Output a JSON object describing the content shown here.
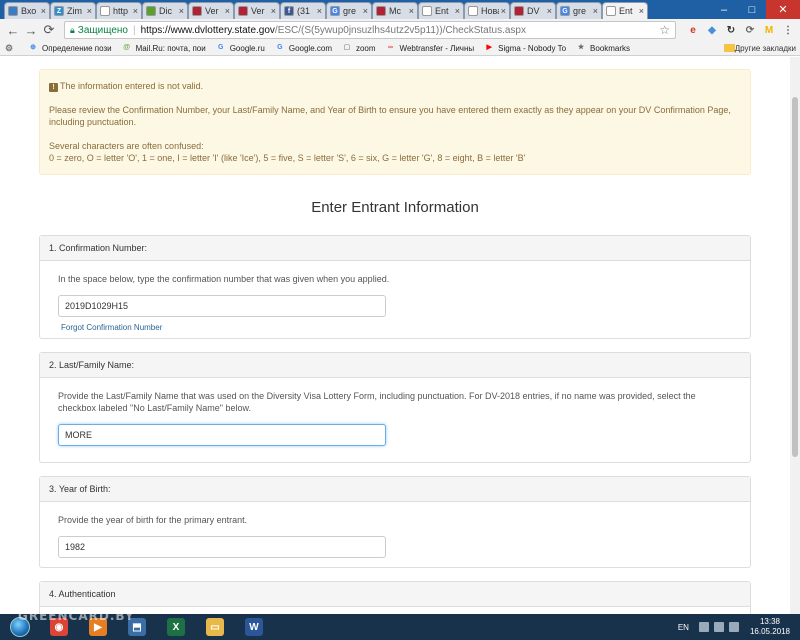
{
  "browser": {
    "tabs": [
      {
        "label": "Вхо",
        "color": "#3b7bc7",
        "glyph": "",
        "active": false
      },
      {
        "label": "Zim",
        "color": "#2c8ed6",
        "glyph": "Z",
        "active": false
      },
      {
        "label": "http",
        "color": "#ffffff",
        "glyph": "",
        "active": false
      },
      {
        "label": "Dic",
        "color": "#5aa02c",
        "glyph": "",
        "active": false
      },
      {
        "label": "Ver",
        "color": "#b22234",
        "glyph": "",
        "active": false
      },
      {
        "label": "Ver",
        "color": "#b22234",
        "glyph": "",
        "active": false
      },
      {
        "label": "(31",
        "color": "#3b5998",
        "glyph": "f",
        "active": false
      },
      {
        "label": "gre",
        "color": "#4285f4",
        "glyph": "G",
        "active": false
      },
      {
        "label": "Mc",
        "color": "#b22234",
        "glyph": "",
        "active": false
      },
      {
        "label": "Ent",
        "color": "#ffffff",
        "glyph": "",
        "active": false
      },
      {
        "label": "Новая",
        "color": "#ffffff",
        "glyph": "",
        "active": false
      },
      {
        "label": "DV",
        "color": "#b22234",
        "glyph": "",
        "active": false
      },
      {
        "label": "gre",
        "color": "#4285f4",
        "glyph": "G",
        "active": false
      },
      {
        "label": "Ent",
        "color": "#ffffff",
        "glyph": "",
        "active": true
      }
    ],
    "tab_close": "×",
    "window_controls": {
      "minimize": "–",
      "maximize": "□",
      "close": "✕"
    },
    "nav": {
      "back": "←",
      "forward": "→",
      "reload": "⟳"
    },
    "address": {
      "secure_label": "Защищено",
      "separator": "|",
      "host": "https://www.dvlottery.state.gov",
      "path": "/ESC/(S(5ywup0jnsuzlhs4utz2v5p11))/CheckStatus.aspx"
    },
    "star": "☆",
    "extensions": [
      {
        "name": "red-circle-extension-icon",
        "glyph": "e",
        "color": "#d93025"
      },
      {
        "name": "shield-extension-icon",
        "glyph": "◆",
        "color": "#4a90d9"
      },
      {
        "name": "rotate-extension-icon",
        "glyph": "↻",
        "color": "#333333"
      },
      {
        "name": "refresh-extension-icon",
        "glyph": "⟳",
        "color": "#666666"
      },
      {
        "name": "m-extension-icon",
        "glyph": "M",
        "color": "#f4b400"
      },
      {
        "name": "menu-icon",
        "glyph": "⋮",
        "color": "#555555"
      }
    ],
    "bookmarks": [
      {
        "label": "Определение пози",
        "color": "#4285f4",
        "glyph": "⊕"
      },
      {
        "label": "Mail.Ru: почта, пои",
        "color": "#6aa84f",
        "glyph": "@"
      },
      {
        "label": "Google.ru",
        "color": "#4285f4",
        "glyph": "G"
      },
      {
        "label": "Google.com",
        "color": "#4285f4",
        "glyph": "G"
      },
      {
        "label": "zoom",
        "color": "#999999",
        "glyph": "▢"
      },
      {
        "label": "Webtransfer - Личны",
        "color": "#e74c3c",
        "glyph": "∞"
      },
      {
        "label": "Sigma - Nobody To",
        "color": "#ff0000",
        "glyph": "▶"
      },
      {
        "label": "Bookmarks",
        "color": "#666666",
        "glyph": "★"
      }
    ],
    "bookmarks_apps_icon": "⚙",
    "other_bookmarks": "Другие закладки"
  },
  "page": {
    "alert": {
      "title": "The information entered is not valid.",
      "line1": "Please review the Confirmation Number, your Last/Family Name, and Year of Birth to ensure you have entered them exactly as they appear on your DV Confirmation Page, including punctuation.",
      "line2": "Several characters are often confused:",
      "line3": "0 = zero, O = letter 'O', 1 = one, I = letter 'I' (like 'Ice'), 5 = five, S = letter 'S', 6 = six, G = letter 'G', 8 = eight, B = letter 'B'"
    },
    "heading": "Enter Entrant Information",
    "confirmation": {
      "label": "1. Confirmation Number:",
      "hint": "In the space below, type the confirmation number that was given when you applied.",
      "value": "2019D1029H15",
      "forgot_link": "Forgot Confirmation Number"
    },
    "lastname": {
      "label": "2. Last/Family Name:",
      "hint": "Provide the Last/Family Name that was used on the Diversity Visa Lottery Form, including punctuation. For DV-2018 entries, if no name was provided, select the checkbox labeled \"No Last/Family Name\" below.",
      "value": "MORE"
    },
    "birth": {
      "label": "3. Year of Birth:",
      "hint": "Provide the year of birth for the primary entrant.",
      "value": "1982"
    },
    "auth": {
      "label": "4. Authentication"
    }
  },
  "taskbar": {
    "watermark": "GREENCARD.BY",
    "apps": [
      {
        "name": "chrome-taskbar-icon",
        "glyph": "◉",
        "color": "#db4437"
      },
      {
        "name": "media-player-taskbar-icon",
        "glyph": "▶",
        "color": "#e67e22"
      },
      {
        "name": "network-taskbar-icon",
        "glyph": "⬒",
        "color": "#3a6ea5"
      },
      {
        "name": "excel-taskbar-icon",
        "glyph": "X",
        "color": "#1e7145"
      },
      {
        "name": "explorer-taskbar-icon",
        "glyph": "▭",
        "color": "#e8b84a"
      },
      {
        "name": "word-taskbar-icon",
        "glyph": "W",
        "color": "#2b579a"
      }
    ],
    "lang": "EN",
    "time": "13:38",
    "date": "16.05.2018"
  }
}
